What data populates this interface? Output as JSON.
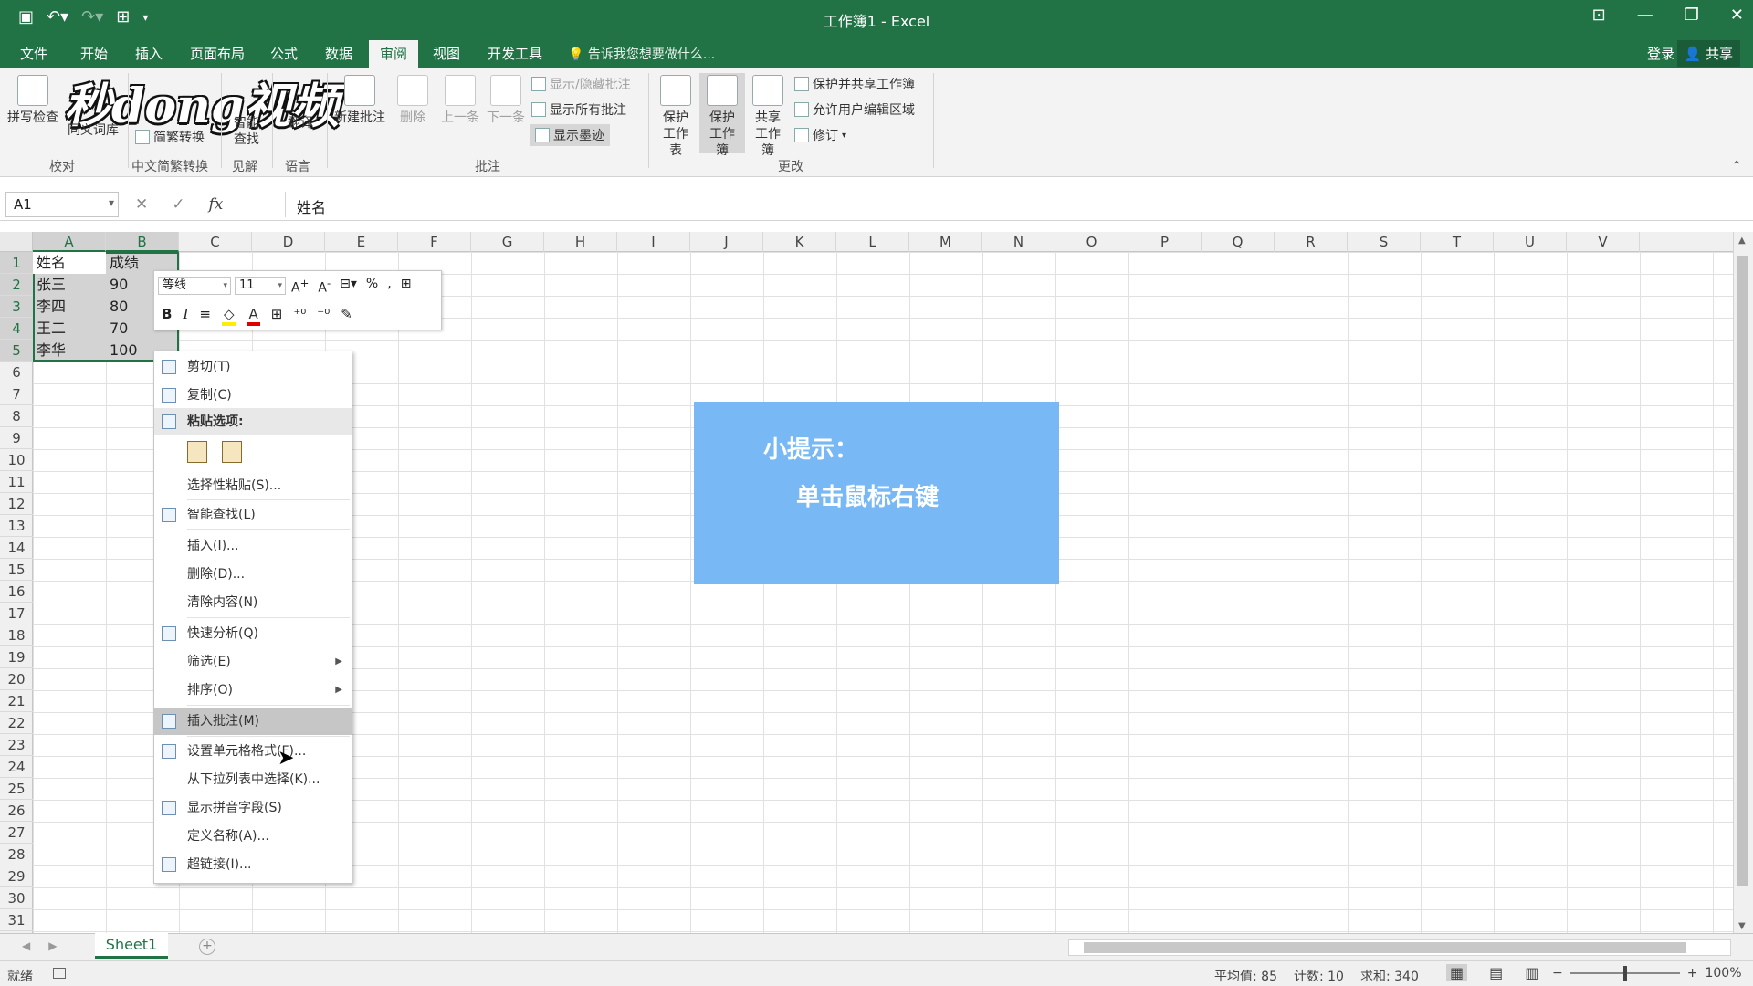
{
  "window": {
    "title": "工作簿1 - Excel",
    "qat_icons": [
      "save-icon",
      "undo-icon",
      "redo-icon",
      "quick-access-icon",
      "customize-icon"
    ]
  },
  "tabs": [
    {
      "label": "文件"
    },
    {
      "label": "开始"
    },
    {
      "label": "插入"
    },
    {
      "label": "页面布局"
    },
    {
      "label": "公式"
    },
    {
      "label": "数据"
    },
    {
      "label": "审阅",
      "active": true
    },
    {
      "label": "视图"
    },
    {
      "label": "开发工具"
    }
  ],
  "tellme": "告诉我您想要做什么...",
  "account": {
    "login": "登录",
    "share": "共享"
  },
  "watermark": "秒dong视频",
  "ribbon": {
    "proofing": {
      "spell": "拼写检查",
      "thesaurus": "同义词库",
      "group": "校对"
    },
    "chinese": {
      "convert": "简繁转换",
      "group": "中文简繁转换"
    },
    "insights": {
      "smart_lookup": "智能查找",
      "group": "见解"
    },
    "language": {
      "translate": "翻译",
      "group": "语言"
    },
    "comments": {
      "new": "新建批注",
      "delete": "删除",
      "prev": "上一条",
      "next": "下一条",
      "show_hide": "显示/隐藏批注",
      "show_all": "显示所有批注",
      "show_ink": "显示墨迹",
      "group": "批注"
    },
    "changes": {
      "protect_sheet": "保护工作表",
      "protect_workbook": "保护工作簿",
      "share_workbook": "共享工作簿",
      "protect_share": "保护并共享工作簿",
      "allow_edit": "允许用户编辑区域",
      "track": "修订",
      "group": "更改"
    }
  },
  "formula_bar": {
    "name_box": "A1",
    "content": "姓名"
  },
  "columns": [
    "A",
    "B",
    "C",
    "D",
    "E",
    "F",
    "G",
    "H",
    "I",
    "J",
    "K",
    "L",
    "M",
    "N",
    "O",
    "P",
    "Q",
    "R",
    "S",
    "T",
    "U",
    "V"
  ],
  "rows": [
    "1",
    "2",
    "3",
    "4",
    "5",
    "6",
    "7",
    "8",
    "9",
    "10",
    "11",
    "12",
    "13",
    "14",
    "15",
    "16",
    "17",
    "18",
    "19",
    "20",
    "21",
    "22",
    "23",
    "24",
    "25",
    "26",
    "27",
    "28",
    "29",
    "30",
    "31"
  ],
  "table": [
    [
      "姓名",
      "成绩"
    ],
    [
      "张三",
      "90"
    ],
    [
      "李四",
      "80"
    ],
    [
      "王二",
      "70"
    ],
    [
      "李华",
      "100"
    ]
  ],
  "mini_toolbar": {
    "font": "等线",
    "size": "11"
  },
  "context_menu": {
    "cut": "剪切(T)",
    "copy": "复制(C)",
    "paste_options": "粘贴选项:",
    "paste_special": "选择性粘贴(S)...",
    "smart_lookup": "智能查找(L)",
    "insert": "插入(I)...",
    "delete": "删除(D)...",
    "clear": "清除内容(N)",
    "quick_analysis": "快速分析(Q)",
    "filter": "筛选(E)",
    "sort": "排序(O)",
    "insert_comment": "插入批注(M)",
    "format_cells": "设置单元格格式(F)...",
    "pick_list": "从下拉列表中选择(K)...",
    "phonetic": "显示拼音字段(S)",
    "define_name": "定义名称(A)...",
    "hyperlink": "超链接(I)..."
  },
  "tip": {
    "title": "小提示：",
    "body": "单击鼠标右键"
  },
  "sheet": {
    "name": "Sheet1"
  },
  "status": {
    "ready": "就绪",
    "average": "平均值: 85",
    "count": "计数: 10",
    "sum": "求和: 340",
    "zoom": "100%"
  }
}
